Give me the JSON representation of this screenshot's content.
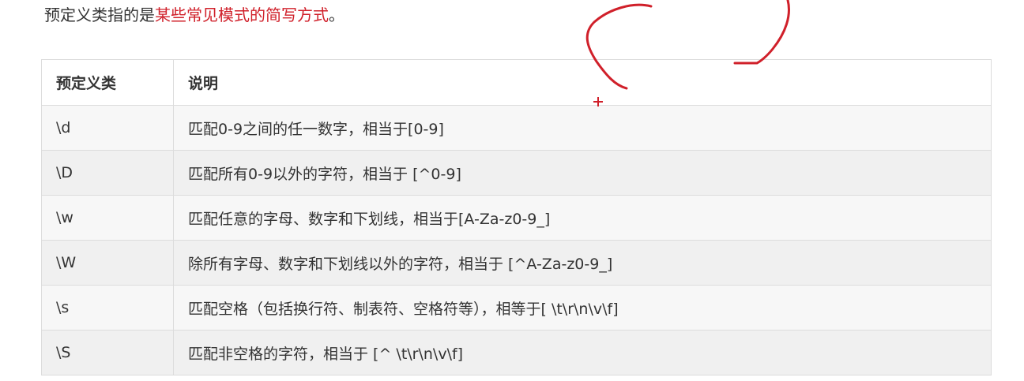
{
  "intro": {
    "prefix": "预定义类指的是",
    "highlight": "某些常见模式的简写方式",
    "suffix": "。"
  },
  "table": {
    "headers": [
      "预定义类",
      "说明"
    ],
    "rows": [
      {
        "cls": "\\d",
        "desc": "匹配0-9之间的任一数字，相当于[0-9]"
      },
      {
        "cls": "\\D",
        "desc": "匹配所有0-9以外的字符，相当于  [^0-9]"
      },
      {
        "cls": "\\w",
        "desc": "匹配任意的字母、数字和下划线，相当于[A-Za-z0-9_]"
      },
      {
        "cls": "\\W",
        "desc": "除所有字母、数字和下划线以外的字符，相当于 [^A-Za-z0-9_]"
      },
      {
        "cls": "\\s",
        "desc": "匹配空格（包括换行符、制表符、空格符等），相等于[ \\t\\r\\n\\v\\f]"
      },
      {
        "cls": "\\S",
        "desc": "匹配非空格的字符，相当于 [^ \\t\\r\\n\\v\\f]"
      }
    ]
  },
  "annotation": {
    "color": "#d0202a"
  }
}
